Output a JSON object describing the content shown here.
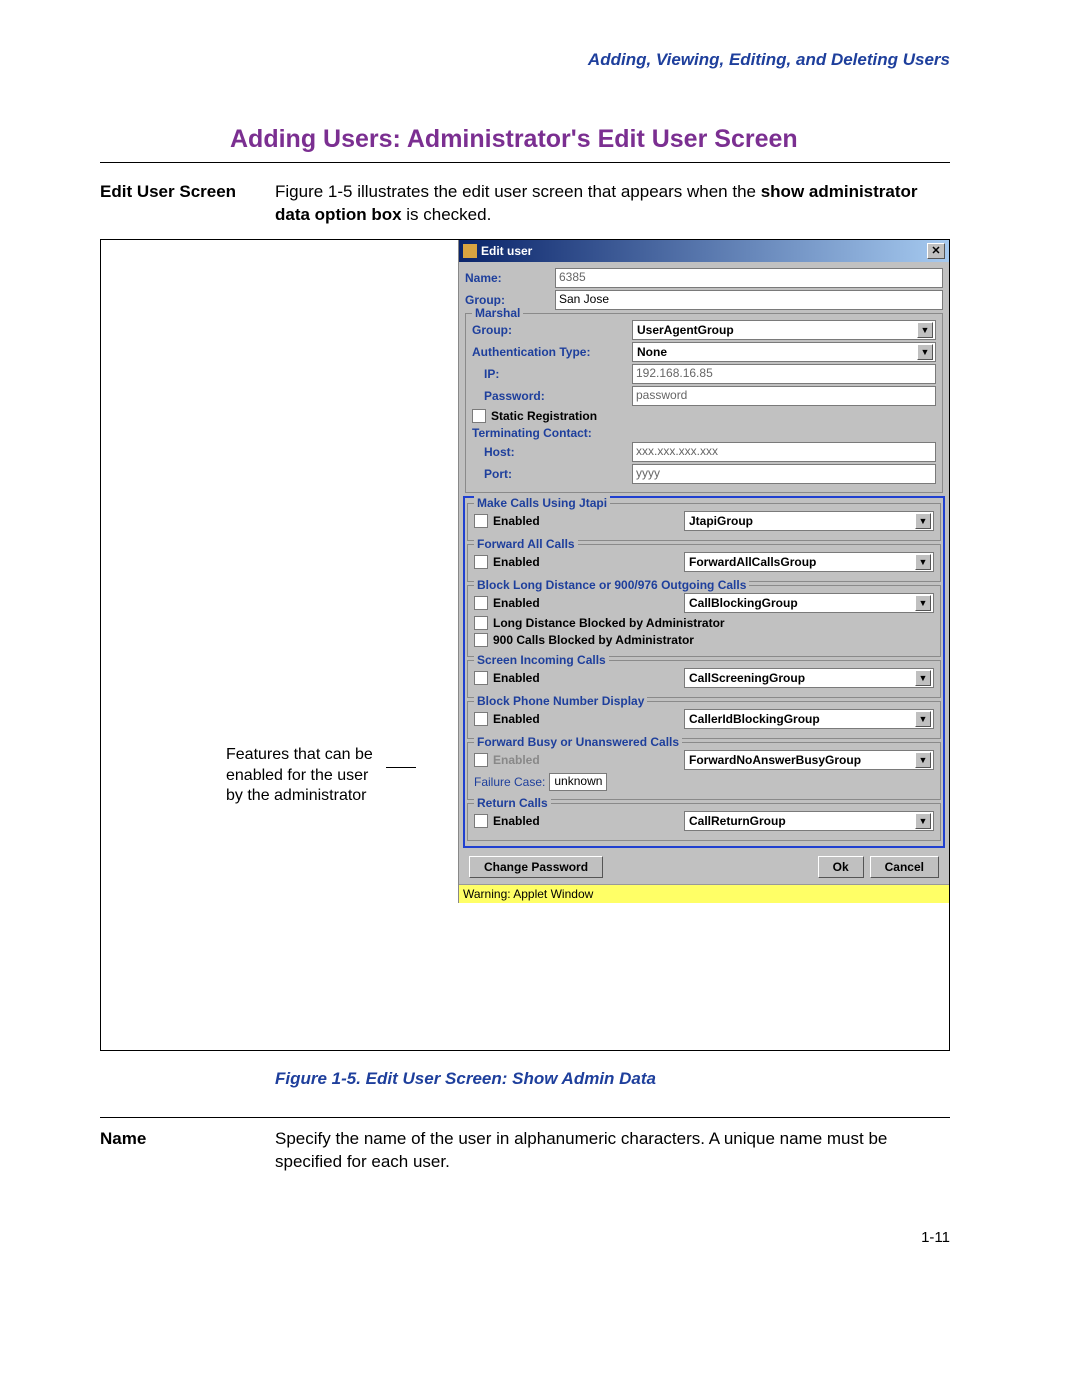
{
  "breadcrumb": "Adding, Viewing, Editing, and Deleting Users",
  "section_title": "Adding Users: Administrator's Edit User Screen",
  "intro": {
    "left": "Edit User Screen",
    "pre": "Figure 1-5 illustrates the edit user screen that appears when the ",
    "bold1": "show administrator data option box",
    "post": " is checked."
  },
  "callout": "Features that can be enabled for the user by the administrator",
  "dialog": {
    "title": "Edit user",
    "name_label": "Name:",
    "name_value": "6385",
    "group_label": "Group:",
    "group_value": "San Jose",
    "marshal": {
      "legend": "Marshal",
      "group_label": "Group:",
      "group_value": "UserAgentGroup",
      "auth_label": "Authentication Type:",
      "auth_value": "None",
      "ip_label": "IP:",
      "ip_value": "192.168.16.85",
      "pw_label": "Password:",
      "pw_value": "password",
      "static_reg": "Static Registration",
      "term_contact": "Terminating Contact:",
      "host_label": "Host:",
      "host_value": "xxx.xxx.xxx.xxx",
      "port_label": "Port:",
      "port_value": "yyyy"
    },
    "jtapi": {
      "legend": "Make Calls Using Jtapi",
      "enabled": "Enabled",
      "group": "JtapiGroup"
    },
    "fwd_all": {
      "legend": "Forward All Calls",
      "enabled": "Enabled",
      "group": "ForwardAllCallsGroup"
    },
    "block": {
      "legend": "Block Long Distance or 900/976 Outgoing Calls",
      "enabled": "Enabled",
      "group": "CallBlockingGroup",
      "ld_admin": "Long Distance Blocked by Administrator",
      "n900_admin": "900 Calls Blocked by Administrator"
    },
    "screen": {
      "legend": "Screen Incoming Calls",
      "enabled": "Enabled",
      "group": "CallScreeningGroup"
    },
    "cid": {
      "legend": "Block Phone Number Display",
      "enabled": "Enabled",
      "group": "CallerIdBlockingGroup"
    },
    "fwd_na": {
      "legend": "Forward Busy or Unanswered Calls",
      "enabled": "Enabled",
      "group": "ForwardNoAnswerBusyGroup",
      "fail_label": "Failure Case:",
      "fail_value": "unknown"
    },
    "return": {
      "legend": "Return Calls",
      "enabled": "Enabled",
      "group": "CallReturnGroup"
    },
    "buttons": {
      "change_pw": "Change Password",
      "ok": "Ok",
      "cancel": "Cancel"
    },
    "warning": "Warning: Applet Window"
  },
  "figure_caption": "Figure 1-5. Edit User Screen: Show Admin Data",
  "name_section": {
    "left": "Name",
    "right": "Specify the name of the user in alphanumeric characters. A unique name must be specified for each user."
  },
  "page_number": "1-11"
}
